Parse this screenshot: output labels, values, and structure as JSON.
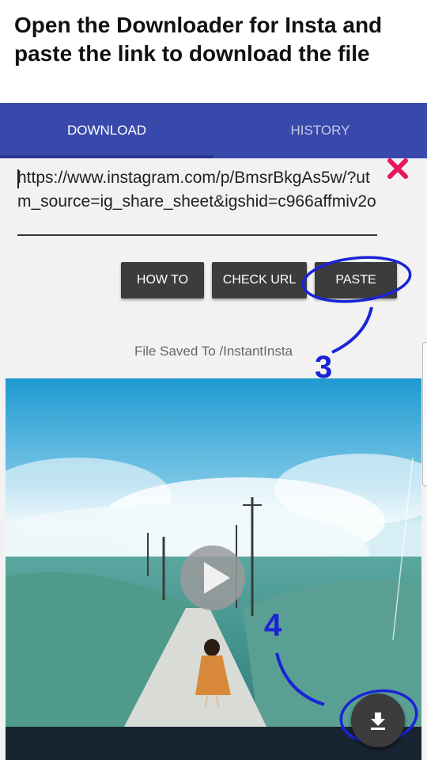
{
  "caption": "Open the Downloader for Insta and paste the link to download the file",
  "tabs": {
    "download": "DOWNLOAD",
    "history": "HISTORY"
  },
  "url_input": {
    "value": "https://www.instagram.com/p/BmsrBkgAs5w/?utm_source=ig_share_sheet&igshid=c966affmiv2o"
  },
  "buttons": {
    "how_to": "HOW TO",
    "check_url": "CHECK URL",
    "paste": "PASTE"
  },
  "saved_to": "File Saved To /InstantInsta",
  "annotations": {
    "step3": "3",
    "step4": "4"
  },
  "colors": {
    "tabbar": "#3949ab",
    "button": "#3c3c3c",
    "clear_icon": "#e8175d",
    "annotation": "#1a23d6"
  },
  "icons": {
    "clear": "close-icon",
    "play": "play-icon",
    "download": "download-icon"
  }
}
